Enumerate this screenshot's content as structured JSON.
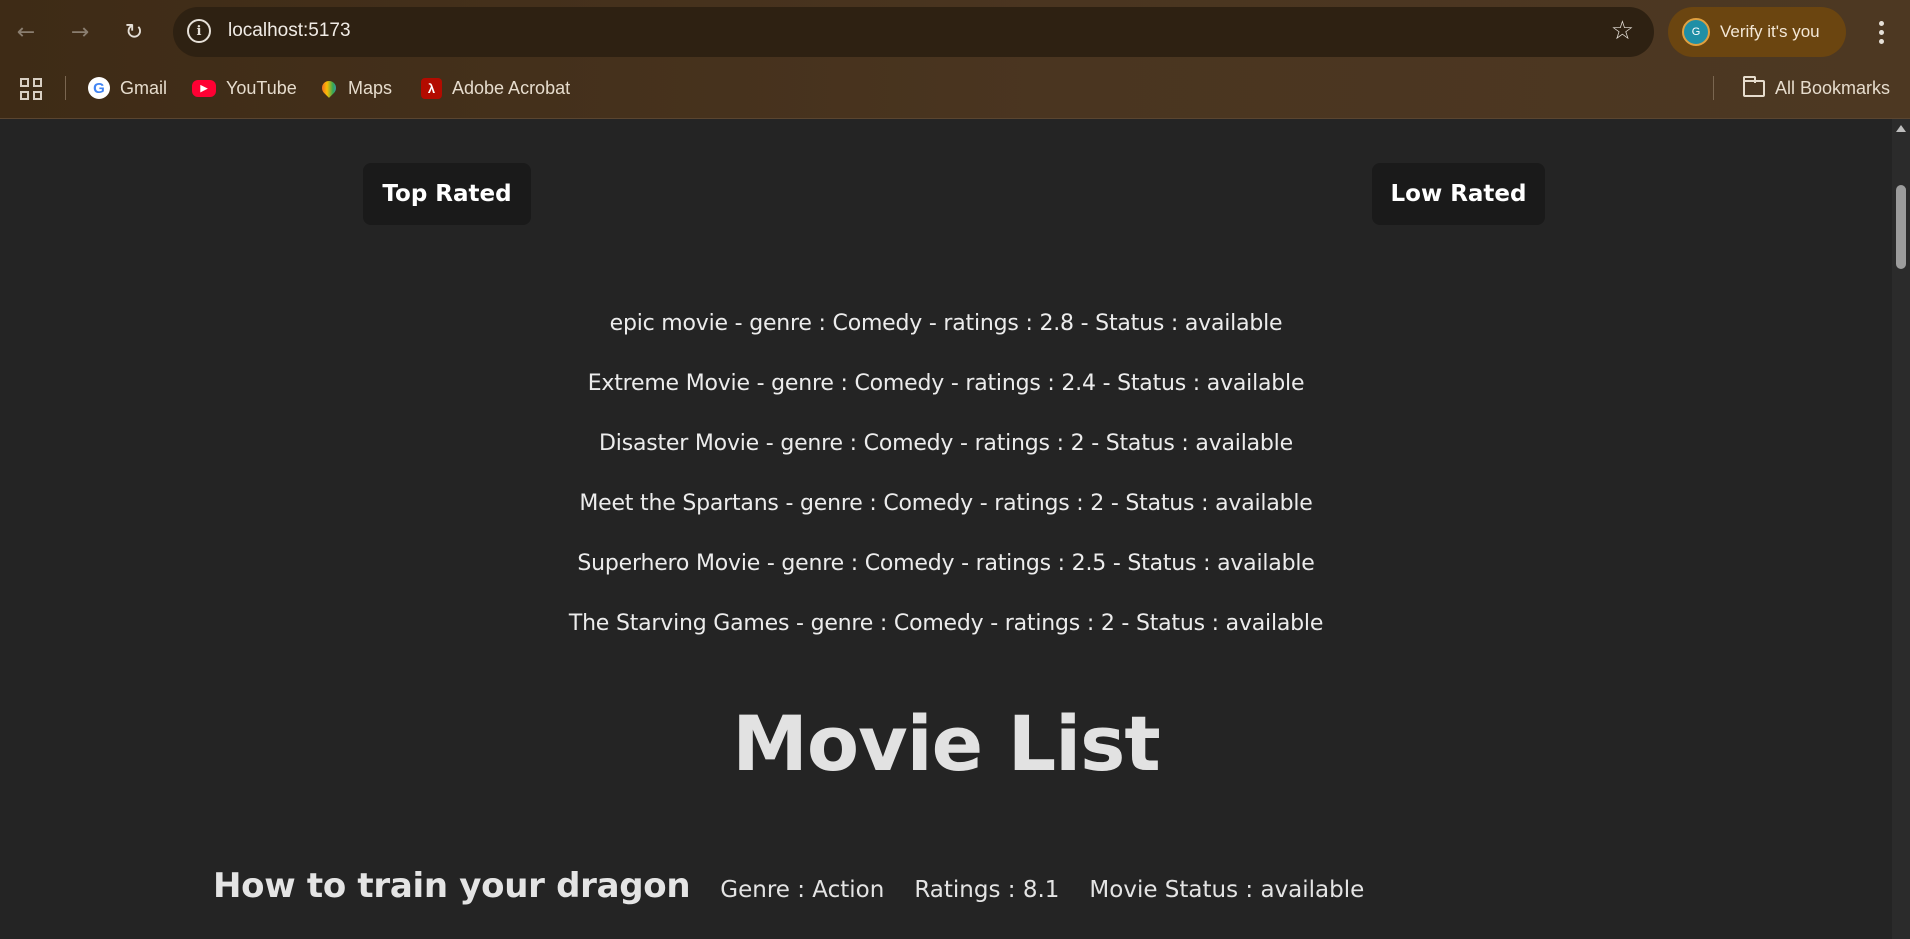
{
  "browser": {
    "url": "localhost:5173",
    "profile_chip": {
      "label": "Verify it's you",
      "avatar_letter": "G"
    },
    "bookmarks": [
      {
        "label": "Gmail",
        "icon": "google-icon"
      },
      {
        "label": "YouTube",
        "icon": "youtube-icon"
      },
      {
        "label": "Maps",
        "icon": "maps-icon"
      },
      {
        "label": "Adobe Acrobat",
        "icon": "adobe-acrobat-icon"
      }
    ],
    "all_bookmarks_label": "All Bookmarks"
  },
  "page": {
    "buttons": {
      "top_rated": "Top Rated",
      "low_rated": "Low Rated"
    },
    "filtered_movies": [
      "epic movie - genre : Comedy - ratings : 2.8 - Status : available",
      "Extreme Movie - genre : Comedy - ratings : 2.4 - Status : available",
      "Disaster Movie - genre : Comedy - ratings : 2 - Status : available",
      "Meet the Spartans - genre : Comedy - ratings : 2 - Status : available",
      "Superhero Movie - genre : Comedy - ratings : 2.5 - Status : available",
      "The Starving Games - genre : Comedy - ratings : 2 - Status : available"
    ],
    "title": "Movie List",
    "movies": [
      {
        "name": "How to train your dragon",
        "genre": "Genre : Action",
        "ratings": "Ratings : 8.1",
        "status": "Movie Status : available"
      }
    ]
  }
}
